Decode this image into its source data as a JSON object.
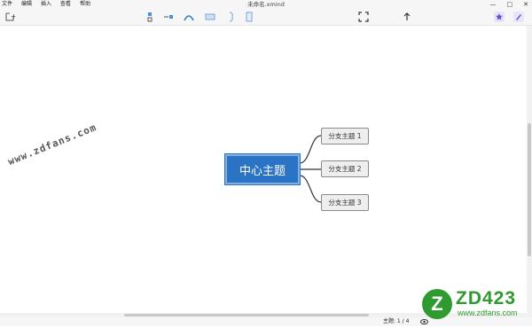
{
  "menu": {
    "file": "文件",
    "edit": "编辑",
    "insert": "插入",
    "view": "查看",
    "help": "帮助"
  },
  "window": {
    "title": "未命名.xmind",
    "minimize": "—",
    "maximize": "□",
    "close": "✕"
  },
  "toolbar": {
    "add_label": "+"
  },
  "mindmap": {
    "central_topic": "中心主题",
    "subtopics": [
      "分支主题 1",
      "分支主题 2",
      "分支主题 3"
    ]
  },
  "status": {
    "topic_count": "主题: 1 / 4"
  },
  "watermark": {
    "text": "www.zdfans.com"
  },
  "logo": {
    "letter": "Z",
    "name": "ZD423",
    "url": "www.zdfans.com"
  },
  "colors": {
    "central": "#2b73c4",
    "subtopic_bg": "#eeeeee",
    "logo": "#2f9a2f",
    "accent_purple": "#6b4fd8"
  }
}
